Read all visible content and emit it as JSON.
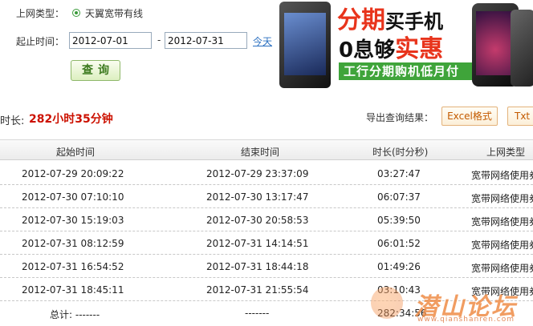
{
  "form": {
    "access_type_label": "上网类型：",
    "access_type_option": "天翼宽带有线",
    "date_range_label": "起止时间：",
    "start_date": "2012-07-01",
    "date_separator": "-",
    "end_date": "2012-07-31",
    "today_link": "今天",
    "query_button": "查询"
  },
  "ad": {
    "line1_red": "分期",
    "line1_black": "买手机",
    "line2_black": "0息够",
    "line2_red": "实惠",
    "strip": "工行分期购机低月付"
  },
  "summary": {
    "duration_label": "时长:",
    "duration_value": "282小时35分钟",
    "export_label": "导出查询结果：",
    "excel_button": "Excel格式",
    "txt_button": "Txt"
  },
  "table": {
    "headers": [
      "起始时间",
      "结束时间",
      "时长(时分秒)",
      "上网类型"
    ],
    "rows": [
      [
        "2012-07-29 20:09:22",
        "2012-07-29 23:37:09",
        "03:27:47",
        "宽带网络使用券"
      ],
      [
        "2012-07-30 07:10:10",
        "2012-07-30 13:17:47",
        "06:07:37",
        "宽带网络使用券"
      ],
      [
        "2012-07-30 15:19:03",
        "2012-07-30 20:58:53",
        "05:39:50",
        "宽带网络使用券"
      ],
      [
        "2012-07-31 08:12:59",
        "2012-07-31 14:14:51",
        "06:01:52",
        "宽带网络使用券"
      ],
      [
        "2012-07-31 16:54:52",
        "2012-07-31 18:44:18",
        "01:49:26",
        "宽带网络使用券"
      ],
      [
        "2012-07-31 18:45:11",
        "2012-07-31 21:55:54",
        "03:10:43",
        "宽带网络使用券"
      ]
    ],
    "total_label": "总计: -------",
    "total_end": "-------",
    "total_duration": "282:34:56"
  },
  "watermark": {
    "text": "潜山论坛",
    "url": "www.qianshanren.com"
  },
  "colors": {
    "accent_green": "#3a9a3a",
    "duration_red": "#cc1100",
    "link_blue": "#2a6fc0"
  }
}
